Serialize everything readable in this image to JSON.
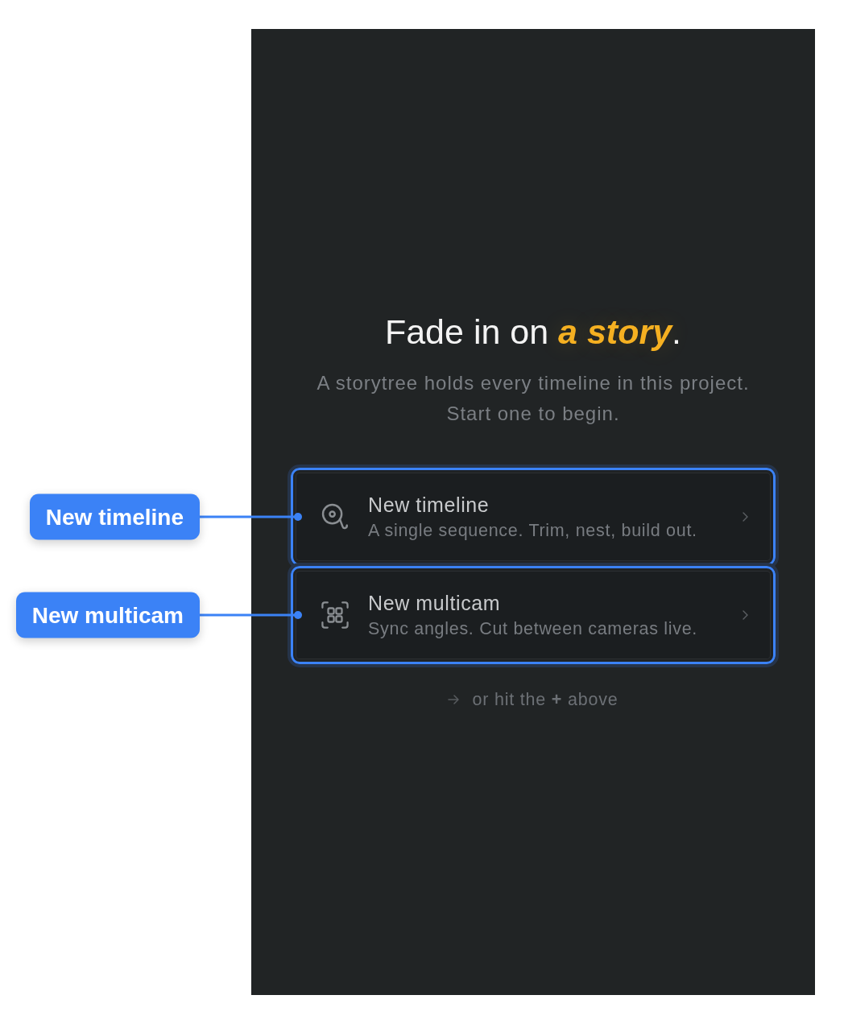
{
  "heading": {
    "parts": [
      {
        "text": "Fade in on ",
        "accent": false
      },
      {
        "text": "a story",
        "accent": true
      },
      {
        "text": ".",
        "accent": false
      }
    ]
  },
  "subtitle": "A storytree holds every timeline in this project. Start one to begin.",
  "options": [
    {
      "kind": "timeline",
      "title": "New timeline",
      "description": "A single sequence. Trim, nest, build out.",
      "highlighted": true,
      "callout": "New timeline"
    },
    {
      "kind": "multicam",
      "title": "New multicam",
      "description": "Sync angles. Cut between cameras live.",
      "highlighted": true,
      "callout": "New multicam"
    }
  ],
  "hint": "or hit the **+** above"
}
